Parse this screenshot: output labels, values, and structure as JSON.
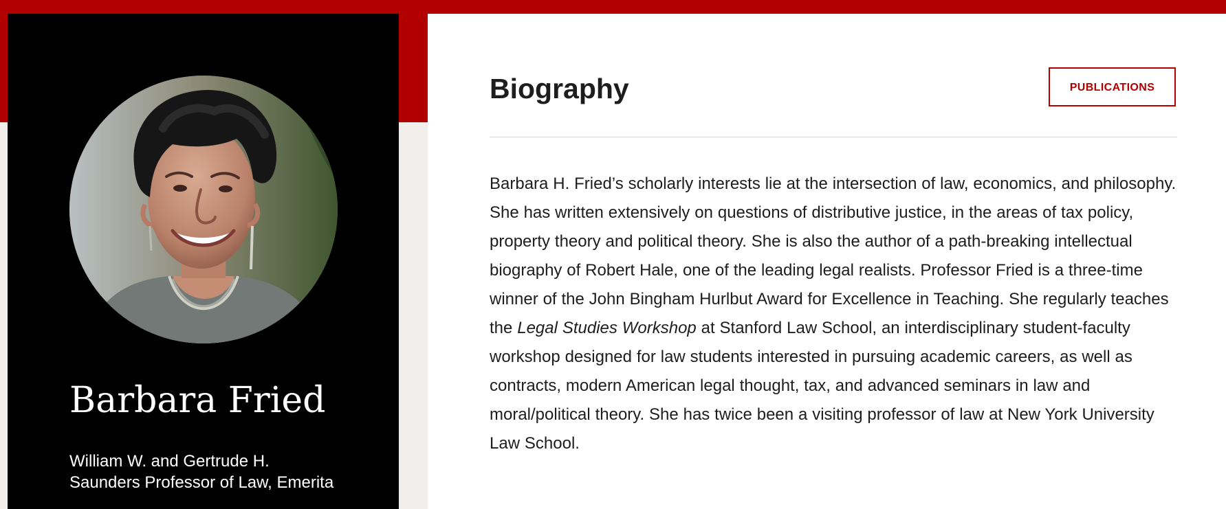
{
  "profile": {
    "name": "Barbara Fried",
    "title": "William W. and Gertrude H. Saunders Professor of Law, Emerita",
    "portrait_icon": "person-portrait"
  },
  "biography": {
    "heading": "Biography",
    "publications_button": "PUBLICATIONS",
    "text_part_1": "Barbara H. Fried’s scholarly interests lie at the intersection of law, economics, and philosophy. She has written extensively on questions of distributive justice, in the areas of tax policy, property theory and political theory. She is also the author of a path-breaking intellectual biography of Robert Hale, one of the leading legal realists. Professor Fried is a three-time winner of the John Bingham Hurlbut Award for Excellence in Teaching. She regularly teaches the ",
    "text_emphasis": "Legal Studies Workshop",
    "text_part_2": " at Stanford Law School, an interdisciplinary student-faculty workshop designed for law students interested in pursuing academic careers, as well as contracts, modern American legal thought, tax, and advanced seminars in law and moral/political theory. She has twice been a visiting professor of law at New York University Law School."
  },
  "colors": {
    "accent_red": "#b20000",
    "page_background": "#f1eeeb",
    "profile_card": "#000000",
    "content_background": "#ffffff",
    "text": "#1d1d1d"
  }
}
